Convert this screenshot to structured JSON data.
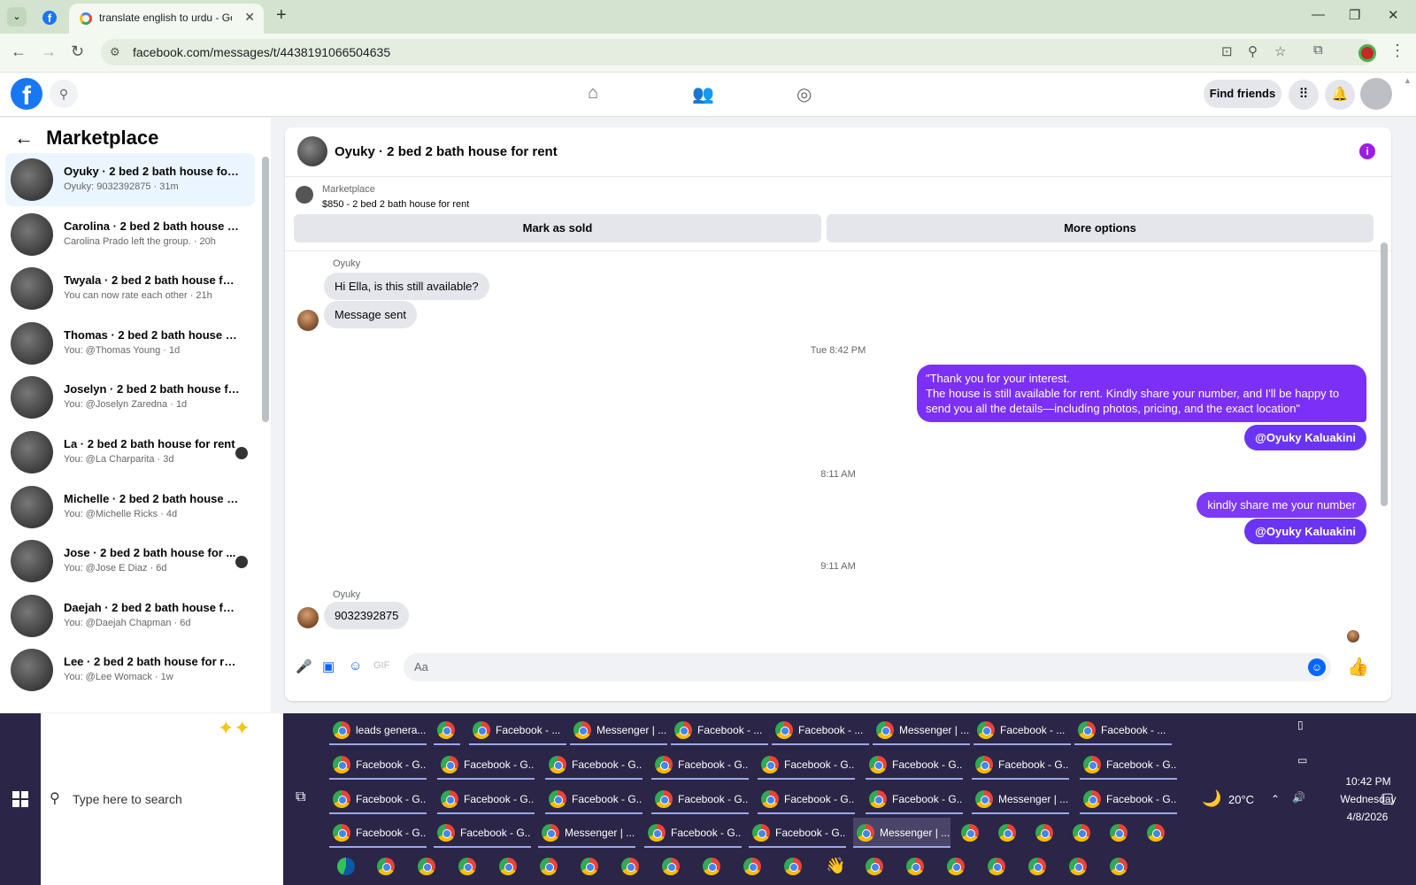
{
  "browser": {
    "tab_active_title": "translate english to urdu - Goo",
    "url": "facebook.com/messages/t/4438191066504635",
    "new_tab": "+",
    "controls": {
      "minimize": "—",
      "maximize": "❐",
      "close": "✕"
    }
  },
  "fb_header": {
    "find_friends": "Find friends"
  },
  "sidebar": {
    "title": "Marketplace",
    "conversations": [
      {
        "name": "Oyuky · 2 bed 2 bath house for ...",
        "sub": "Oyuky: 9032392875 · 31m",
        "active": true,
        "dot": false
      },
      {
        "name": "Carolina · 2 bed 2 bath house fo...",
        "sub": "Carolina Prado left the group. · 20h",
        "active": false,
        "dot": false
      },
      {
        "name": "Twyala · 2 bed 2 bath house for ...",
        "sub": "You can now rate each other · 21h",
        "active": false,
        "dot": false
      },
      {
        "name": "Thomas · 2 bed 2 bath house fo...",
        "sub": "You: @Thomas Young · 1d",
        "active": false,
        "dot": false
      },
      {
        "name": "Joselyn · 2 bed 2 bath house for...",
        "sub": "You: @Joselyn Zaredna · 1d",
        "active": false,
        "dot": false
      },
      {
        "name": "La · 2 bed 2 bath house for rent",
        "sub": "You: @La Charparita · 3d",
        "active": false,
        "dot": true
      },
      {
        "name": "Michelle · 2 bed 2 bath house fo...",
        "sub": "You: @Michelle Ricks · 4d",
        "active": false,
        "dot": false
      },
      {
        "name": "Jose · 2 bed 2 bath house for ...",
        "sub": "You: @Jose E Diaz · 6d",
        "active": false,
        "dot": true
      },
      {
        "name": "Daejah · 2 bed 2 bath house for ...",
        "sub": "You: @Daejah Chapman · 6d",
        "active": false,
        "dot": false
      },
      {
        "name": "Lee · 2 bed 2 bath house for rent",
        "sub": "You: @Lee Womack · 1w",
        "active": false,
        "dot": false
      }
    ]
  },
  "chat": {
    "title": "Oyuky · 2 bed 2 bath house for rent",
    "listing_source": "Marketplace",
    "listing_price": "$850 - 2 bed 2 bath house for rent",
    "mark_sold": "Mark as sold",
    "more_options": "More options",
    "sender_name": "Oyuky",
    "msg_in_1": "Hi Ella, is this still available?",
    "msg_in_2": "Message sent",
    "time_1": "Tue 8:42 PM",
    "msg_out_1": "\"Thank you for your interest.\nThe house is still available for rent. Kindly share your number, and I'll be happy to send you all the details—including photos, pricing, and the exact location\"",
    "mention": "@Oyuky Kaluakini",
    "time_2": "8:11 AM",
    "msg_out_2": "kindly share me your number",
    "time_3": "9:11 AM",
    "msg_in_3": "9032392875",
    "composer_placeholder": "Aa"
  },
  "taskbar": {
    "search_placeholder": "Type here to search",
    "rows": [
      [
        "leads genera...",
        "",
        "Facebook - ...",
        "Messenger | ...",
        "Facebook - ...",
        "Facebook - ...",
        "Messenger | ...",
        "Facebook - ...",
        "Facebook - ..."
      ],
      [
        "Facebook - G...",
        "Facebook - G...",
        "Facebook - G...",
        "Facebook - G...",
        "Facebook - G...",
        "Facebook - G...",
        "Facebook - G...",
        "Facebook - G..."
      ],
      [
        "Facebook - G...",
        "Facebook - G...",
        "Facebook - G...",
        "Facebook - G...",
        "Facebook - G...",
        "Facebook - G...",
        "Messenger | ...",
        "Facebook - G..."
      ],
      [
        "Facebook - G...",
        "Facebook - G...",
        "Messenger | ...",
        "Facebook - G...",
        "Facebook - G...",
        "Messenger | ..."
      ]
    ],
    "weather": "20°C",
    "time": "10:42 PM",
    "day": "Wednesday",
    "date": "4/8/2026"
  }
}
